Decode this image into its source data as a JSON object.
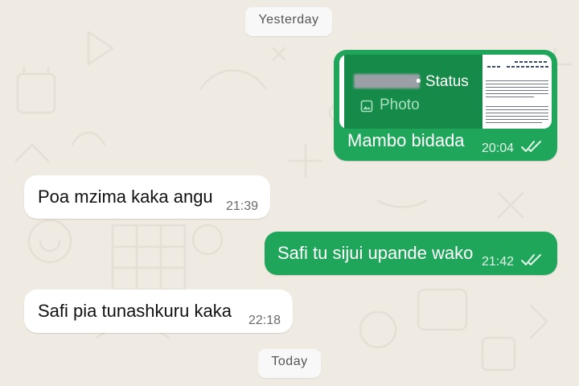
{
  "chat": {
    "separators": {
      "yesterday": "Yesterday",
      "today": "Today"
    },
    "messages": [
      {
        "direction": "outgoing",
        "reply_to": {
          "source_suffix": "• Status",
          "media_type": "Photo",
          "media_icon": "image-icon"
        },
        "text": "Mambo bidada",
        "time": "20:04",
        "status": "read"
      },
      {
        "direction": "incoming",
        "text": "Poa mzima kaka angu",
        "time": "21:39"
      },
      {
        "direction": "outgoing",
        "text": "Safi tu sijui upande wako",
        "time": "21:42",
        "status": "read"
      },
      {
        "direction": "incoming",
        "text": "Safi pia tunashkuru kaka",
        "time": "22:18"
      }
    ]
  },
  "colors": {
    "wallpaper": "#efeae2",
    "outgoing_bubble": "#1fa65a",
    "incoming_bubble": "#ffffff",
    "quote_background": "#168a48"
  }
}
